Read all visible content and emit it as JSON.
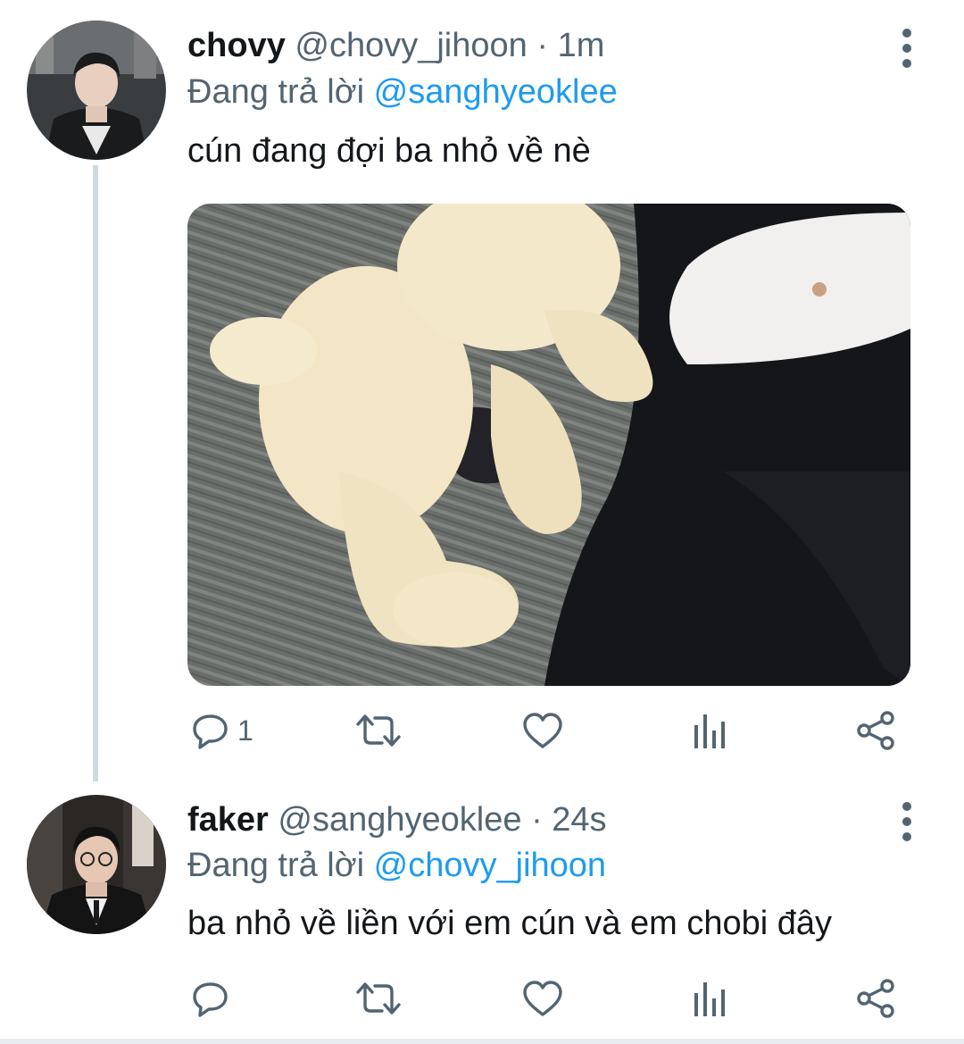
{
  "theme": {
    "accent": "#1d9bf0",
    "muted": "#536471",
    "thread_line": "#cfd9de"
  },
  "tweets": [
    {
      "name": "chovy",
      "handle": "@chovy_jihoon",
      "separator": "·",
      "time": "1m",
      "reply_prefix": "Đang trả lời",
      "reply_to": "@sanghyeoklee",
      "text": "cún đang đợi ba nhỏ về nè",
      "reply_count": "1",
      "icons": [
        "more-vert-icon",
        "reply-icon",
        "retweet-icon",
        "like-icon",
        "analytics-icon",
        "share-icon"
      ]
    },
    {
      "name": "faker",
      "handle": "@sanghyeoklee",
      "separator": "·",
      "time": "24s",
      "reply_prefix": "Đang trả lời",
      "reply_to": "@chovy_jihoon",
      "text": "ba nhỏ về liền với em cún và em chobi đây",
      "reply_count": "",
      "icons": [
        "more-vert-icon",
        "reply-icon",
        "retweet-icon",
        "like-icon",
        "analytics-icon",
        "share-icon"
      ]
    }
  ]
}
